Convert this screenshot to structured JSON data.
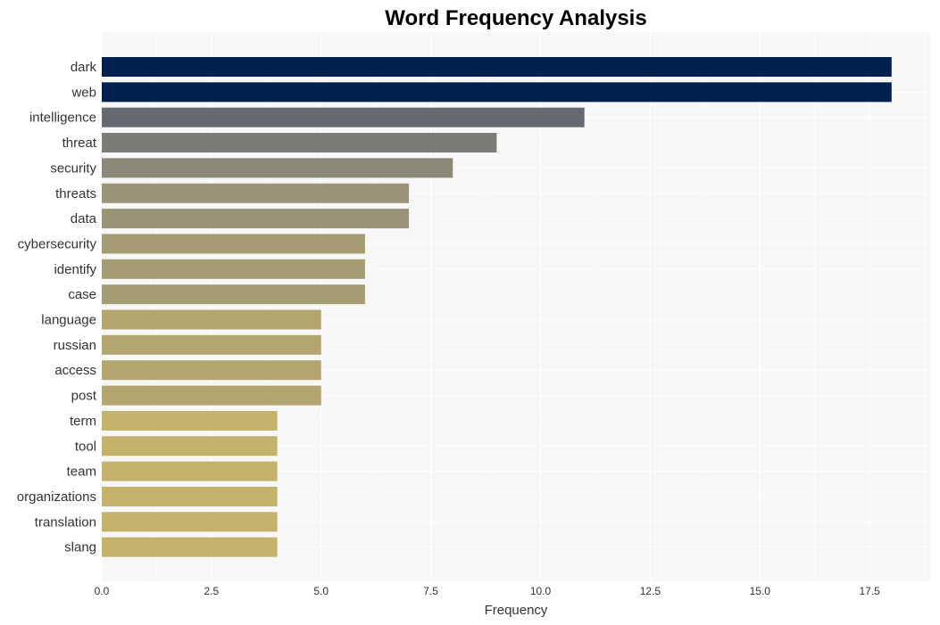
{
  "chart_data": {
    "type": "bar",
    "orientation": "horizontal",
    "title": "Word Frequency Analysis",
    "xlabel": "Frequency",
    "ylabel": "",
    "xlim": [
      0,
      18.9
    ],
    "xticks": [
      "0.0",
      "2.5",
      "5.0",
      "7.5",
      "10.0",
      "12.5",
      "15.0",
      "17.5"
    ],
    "xtick_values": [
      0,
      2.5,
      5,
      7.5,
      10,
      12.5,
      15,
      17.5
    ],
    "grid": true,
    "legend": "none",
    "categories": [
      "dark",
      "web",
      "intelligence",
      "threat",
      "security",
      "threats",
      "data",
      "cybersecurity",
      "identify",
      "case",
      "language",
      "russian",
      "access",
      "post",
      "term",
      "tool",
      "team",
      "organizations",
      "translation",
      "slang"
    ],
    "values": [
      18,
      18,
      11,
      9,
      8,
      7,
      7,
      6,
      6,
      6,
      5,
      5,
      5,
      5,
      4,
      4,
      4,
      4,
      4,
      4
    ],
    "colors": [
      "#00204e",
      "#00204e",
      "#676972",
      "#7c7b78",
      "#8b8878",
      "#9a9377",
      "#9a9377",
      "#a59c74",
      "#a59c74",
      "#a59c74",
      "#b3a56f",
      "#b3a56f",
      "#b3a56f",
      "#b3a56f",
      "#c4b26a",
      "#c4b26a",
      "#c4b26a",
      "#c4b26a",
      "#c4b26a",
      "#c4b26a"
    ]
  },
  "style": {
    "plot_background": "#f7f7f7",
    "grid_color": "#ffffff"
  }
}
